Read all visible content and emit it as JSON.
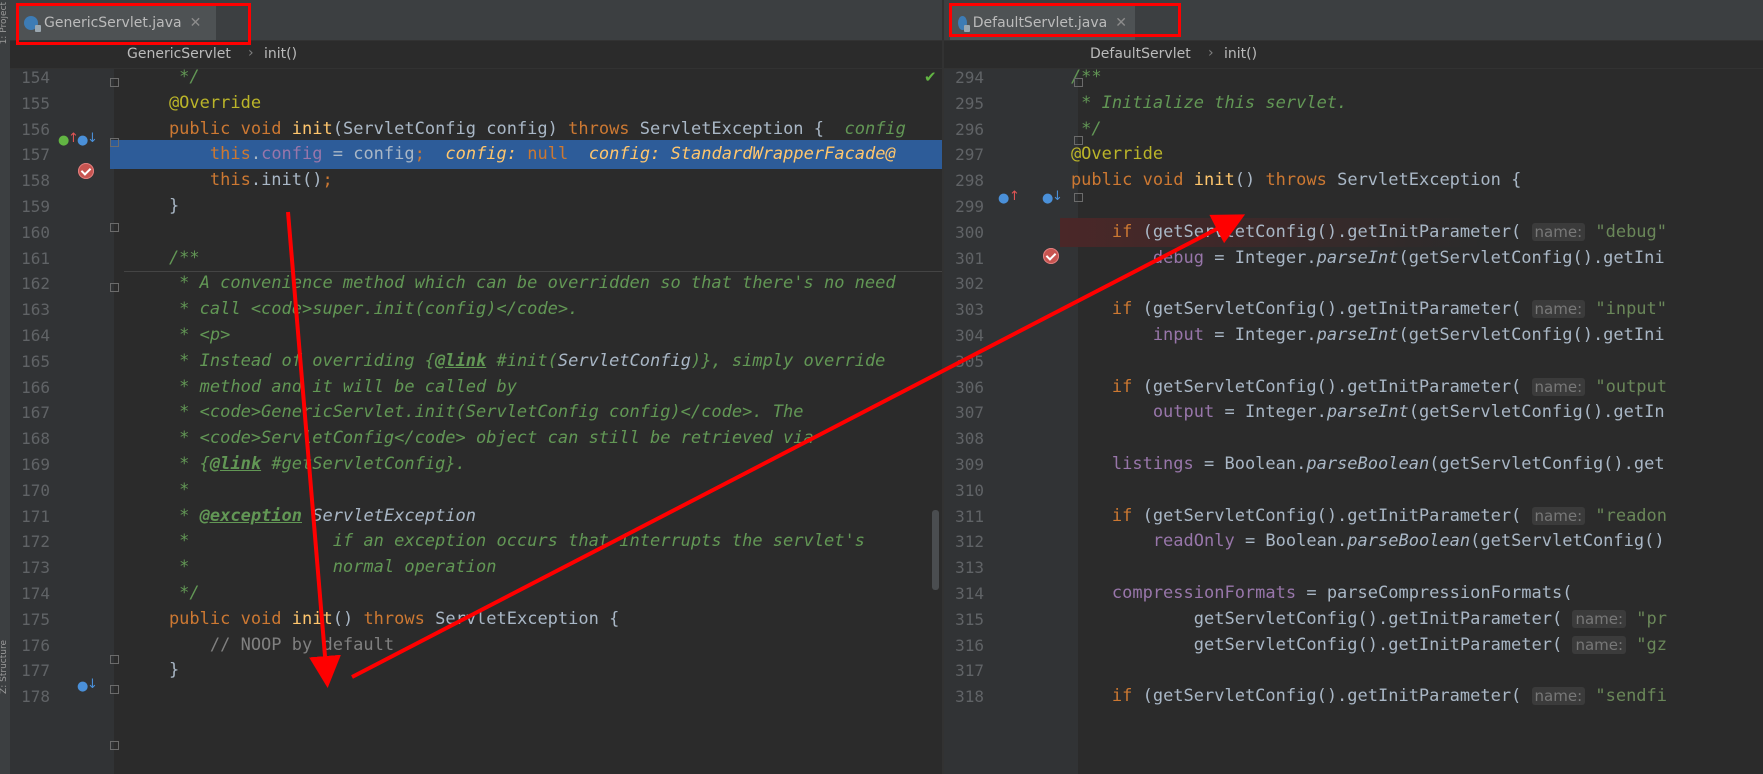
{
  "sidebar": {
    "top_label": "1: Project",
    "bottom_label": "Z: Structure"
  },
  "left": {
    "tab": {
      "title": "GenericServlet.java",
      "icon": "class-file-icon"
    },
    "breadcrumb": [
      "GenericServlet",
      "init()"
    ],
    "lines": [
      {
        "n": "154",
        "segs": [
          [
            "cmt",
            "     */"
          ]
        ]
      },
      {
        "n": "155",
        "segs": [
          [
            "ann",
            "    @Override"
          ]
        ]
      },
      {
        "n": "156",
        "segs": [
          [
            "kw",
            "    public void "
          ],
          [
            "fn",
            "init"
          ],
          [
            "",
            "(ServletConfig config) "
          ],
          [
            "kw",
            "throws "
          ],
          [
            "",
            "ServletException {  "
          ],
          [
            "cmt",
            "config"
          ]
        ]
      },
      {
        "n": "157",
        "segs": [
          [
            "kw",
            "        this"
          ],
          [
            "",
            "."
          ],
          [
            "fld",
            "config"
          ],
          [
            "",
            " = config"
          ],
          [
            "kw",
            ";"
          ],
          [
            "",
            "  "
          ],
          [
            "dbg",
            "config: "
          ],
          [
            "kw",
            "null"
          ],
          [
            "",
            "  "
          ],
          [
            "dbg",
            "config: "
          ],
          [
            "dbg",
            "StandardWrapperFacade@"
          ]
        ]
      },
      {
        "n": "158",
        "segs": [
          [
            "kw",
            "        this"
          ],
          [
            "",
            ".init()"
          ],
          [
            "kw",
            ";"
          ]
        ]
      },
      {
        "n": "159",
        "segs": [
          [
            "",
            "    }"
          ]
        ]
      },
      {
        "n": "160",
        "segs": [
          [
            "",
            ""
          ]
        ]
      },
      {
        "n": "161",
        "segs": [
          [
            "cmt",
            "    /**"
          ]
        ]
      },
      {
        "n": "162",
        "segs": [
          [
            "cmt",
            "     * A convenience method which can be overridden so that there's no need"
          ]
        ]
      },
      {
        "n": "163",
        "segs": [
          [
            "cmt",
            "     * call <code>super.init(config)</code>."
          ]
        ]
      },
      {
        "n": "164",
        "segs": [
          [
            "cmt",
            "     * <p>"
          ]
        ]
      },
      {
        "n": "165",
        "segs": [
          [
            "cmt",
            "     * Instead of overriding {"
          ],
          [
            "tag",
            "@link"
          ],
          [
            "cmt",
            " #init("
          ],
          [
            "cmtw",
            "ServletConfig"
          ],
          [
            "cmt",
            ")}, simply override"
          ]
        ]
      },
      {
        "n": "166",
        "segs": [
          [
            "cmt",
            "     * method and it will be called by"
          ]
        ]
      },
      {
        "n": "167",
        "segs": [
          [
            "cmt",
            "     * <code>GenericServlet.init(ServletConfig config)</code>. The"
          ]
        ]
      },
      {
        "n": "168",
        "segs": [
          [
            "cmt",
            "     * <code>ServletConfig</code> object can still be retrieved via"
          ]
        ]
      },
      {
        "n": "169",
        "segs": [
          [
            "cmt",
            "     * {"
          ],
          [
            "tag",
            "@link"
          ],
          [
            "cmt",
            " #getServletConfig}."
          ]
        ]
      },
      {
        "n": "170",
        "segs": [
          [
            "cmt",
            "     *"
          ]
        ]
      },
      {
        "n": "171",
        "segs": [
          [
            "cmt",
            "     * "
          ],
          [
            "tag",
            "@exception"
          ],
          [
            "cmt",
            " "
          ],
          [
            "cmtw",
            "ServletException"
          ]
        ]
      },
      {
        "n": "172",
        "segs": [
          [
            "cmt",
            "     *              if an exception occurs that interrupts the servlet's"
          ]
        ]
      },
      {
        "n": "173",
        "segs": [
          [
            "cmt",
            "     *              normal operation"
          ]
        ]
      },
      {
        "n": "174",
        "segs": [
          [
            "cmt",
            "     */"
          ]
        ]
      },
      {
        "n": "175",
        "segs": [
          [
            "kw",
            "    public void "
          ],
          [
            "fn",
            "init"
          ],
          [
            "",
            "() "
          ],
          [
            "kw",
            "throws "
          ],
          [
            "",
            "ServletException {"
          ]
        ]
      },
      {
        "n": "176",
        "segs": [
          [
            "lcmt",
            "        // NOOP by default"
          ]
        ]
      },
      {
        "n": "177",
        "segs": [
          [
            "",
            "    }"
          ]
        ]
      },
      {
        "n": "178",
        "segs": [
          [
            "",
            ""
          ]
        ]
      }
    ]
  },
  "right": {
    "tab": {
      "title": "DefaultServlet.java",
      "icon": "class-file-icon"
    },
    "breadcrumb": [
      "DefaultServlet",
      "init()"
    ],
    "lines": [
      {
        "n": "294",
        "segs": [
          [
            "cmt",
            "    /**"
          ]
        ]
      },
      {
        "n": "295",
        "segs": [
          [
            "cmt",
            "     * Initialize this servlet."
          ]
        ]
      },
      {
        "n": "296",
        "segs": [
          [
            "cmt",
            "     */"
          ]
        ]
      },
      {
        "n": "297",
        "segs": [
          [
            "ann",
            "    @Override"
          ]
        ]
      },
      {
        "n": "298",
        "segs": [
          [
            "kw",
            "    public void "
          ],
          [
            "fn",
            "init"
          ],
          [
            "",
            "() "
          ],
          [
            "kw",
            "throws "
          ],
          [
            "",
            "ServletException {"
          ]
        ]
      },
      {
        "n": "299",
        "segs": [
          [
            "",
            ""
          ]
        ]
      },
      {
        "n": "300",
        "segs": [
          [
            "kw",
            "        if "
          ],
          [
            "",
            "(getServletConfig().getInitParameter( "
          ],
          [
            "hint",
            "name:"
          ],
          [
            "str",
            " \"debug\""
          ]
        ]
      },
      {
        "n": "301",
        "segs": [
          [
            "fld",
            "            debug"
          ],
          [
            "",
            " = Integer."
          ],
          [
            "it",
            "parseInt"
          ],
          [
            "",
            "(getServletConfig().getIni"
          ]
        ]
      },
      {
        "n": "302",
        "segs": [
          [
            "",
            ""
          ]
        ]
      },
      {
        "n": "303",
        "segs": [
          [
            "kw",
            "        if "
          ],
          [
            "",
            "(getServletConfig().getInitParameter( "
          ],
          [
            "hint",
            "name:"
          ],
          [
            "str",
            " \"input\""
          ]
        ]
      },
      {
        "n": "304",
        "segs": [
          [
            "fld",
            "            input"
          ],
          [
            "",
            " = Integer."
          ],
          [
            "it",
            "parseInt"
          ],
          [
            "",
            "(getServletConfig().getIni"
          ]
        ]
      },
      {
        "n": "305",
        "segs": [
          [
            "",
            ""
          ]
        ]
      },
      {
        "n": "306",
        "segs": [
          [
            "kw",
            "        if "
          ],
          [
            "",
            "(getServletConfig().getInitParameter( "
          ],
          [
            "hint",
            "name:"
          ],
          [
            "str",
            " \"output"
          ]
        ]
      },
      {
        "n": "307",
        "segs": [
          [
            "fld",
            "            output"
          ],
          [
            "",
            " = Integer."
          ],
          [
            "it",
            "parseInt"
          ],
          [
            "",
            "(getServletConfig().getIn"
          ]
        ]
      },
      {
        "n": "308",
        "segs": [
          [
            "",
            ""
          ]
        ]
      },
      {
        "n": "309",
        "segs": [
          [
            "fld",
            "        listings"
          ],
          [
            "",
            " = Boolean."
          ],
          [
            "it",
            "parseBoolean"
          ],
          [
            "",
            "(getServletConfig().get"
          ]
        ]
      },
      {
        "n": "310",
        "segs": [
          [
            "",
            ""
          ]
        ]
      },
      {
        "n": "311",
        "segs": [
          [
            "kw",
            "        if "
          ],
          [
            "",
            "(getServletConfig().getInitParameter( "
          ],
          [
            "hint",
            "name:"
          ],
          [
            "str",
            " \"readon"
          ]
        ]
      },
      {
        "n": "312",
        "segs": [
          [
            "fld",
            "            readOnly"
          ],
          [
            "",
            " = Boolean."
          ],
          [
            "it",
            "parseBoolean"
          ],
          [
            "",
            "(getServletConfig()"
          ]
        ]
      },
      {
        "n": "313",
        "segs": [
          [
            "",
            ""
          ]
        ]
      },
      {
        "n": "314",
        "segs": [
          [
            "fld",
            "        compressionFormats"
          ],
          [
            "",
            " = parseCompressionFormats("
          ]
        ]
      },
      {
        "n": "315",
        "segs": [
          [
            "",
            "                getServletConfig().getInitParameter( "
          ],
          [
            "hint",
            "name:"
          ],
          [
            "str",
            " \"pr"
          ]
        ]
      },
      {
        "n": "316",
        "segs": [
          [
            "",
            "                getServletConfig().getInitParameter( "
          ],
          [
            "hint",
            "name:"
          ],
          [
            "str",
            " \"gz"
          ]
        ]
      },
      {
        "n": "317",
        "segs": [
          [
            "",
            ""
          ]
        ]
      },
      {
        "n": "318",
        "segs": [
          [
            "kw",
            "        if "
          ],
          [
            "",
            "(getServletConfig().getInitParameter( "
          ],
          [
            "hint",
            "name:"
          ],
          [
            "str",
            " \"sendfi"
          ]
        ]
      }
    ]
  },
  "colors": {
    "annotation_red": "#ff0000",
    "exec_line": "#2d5c99",
    "breakpoint": "#c75450"
  }
}
